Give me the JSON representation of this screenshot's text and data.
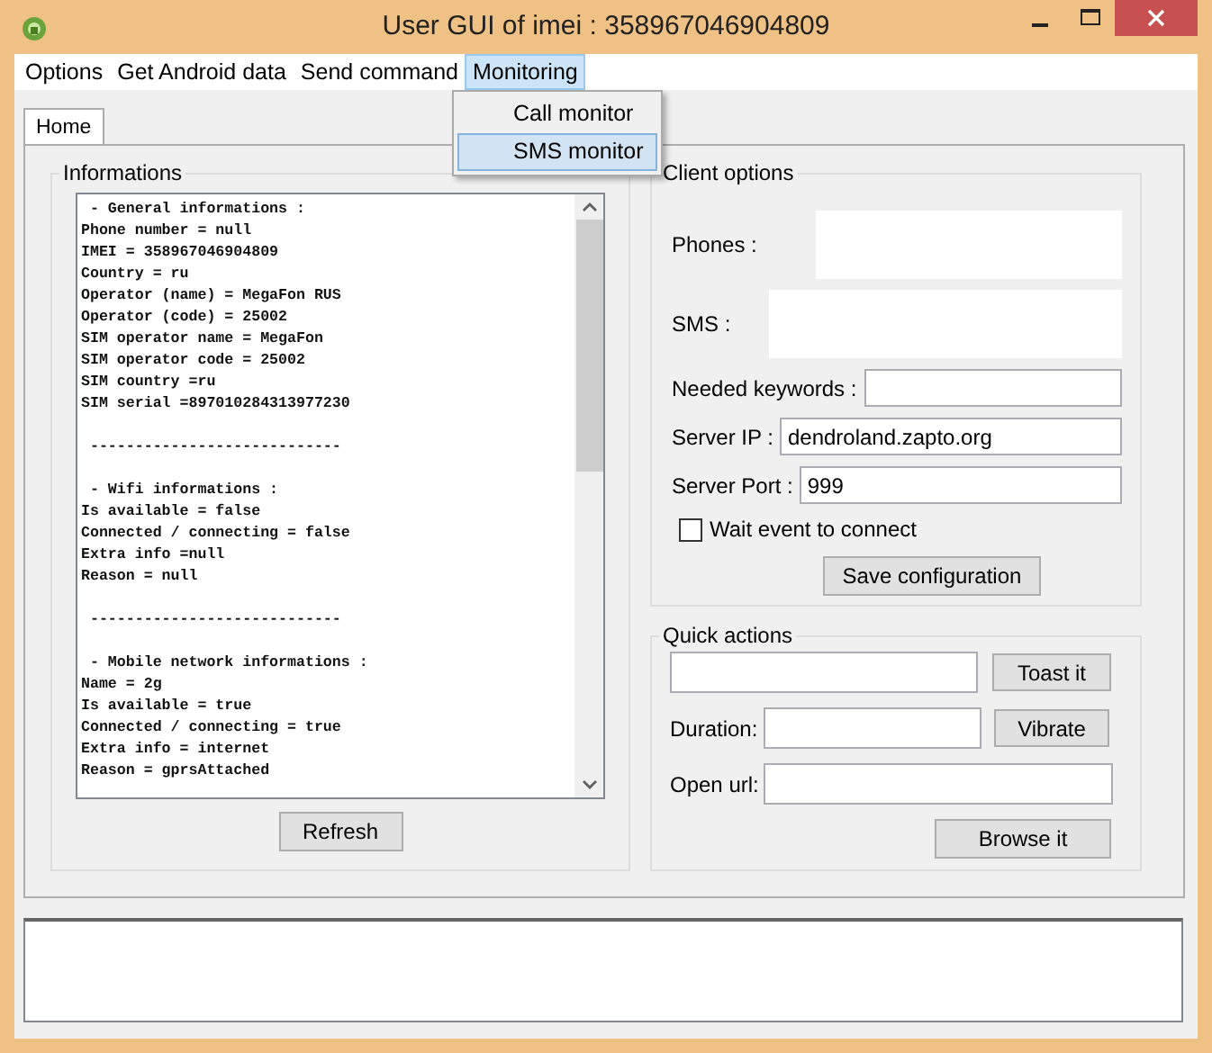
{
  "window": {
    "title": "User GUI of imei : 358967046904809"
  },
  "menu": [
    {
      "label": "Options",
      "selected": false
    },
    {
      "label": "Get Android data",
      "selected": false
    },
    {
      "label": "Send command",
      "selected": false
    },
    {
      "label": "Monitoring",
      "selected": true,
      "expanded": true,
      "items": [
        {
          "label": "Call monitor",
          "selected": false
        },
        {
          "label": "SMS monitor",
          "selected": true
        }
      ]
    }
  ],
  "tabs": [
    {
      "label": "Home",
      "selected": true
    }
  ],
  "informations": {
    "title": "Informations",
    "sections": [
      [
        " - General informations :",
        "Phone number = null",
        "IMEI = 358967046904809",
        "Country = ru",
        "Operator (name) = MegaFon RUS",
        "Operator (code) = 25002",
        "SIM operator name = MegaFon",
        "SIM operator code = 25002",
        "SIM country =ru",
        "SIM serial =897010284313977230"
      ],
      [
        " ----------------------------"
      ],
      [
        " - Wifi informations :",
        "Is available = false",
        "Connected / connecting = false",
        "Extra info =null",
        "Reason = null"
      ],
      [
        " ----------------------------"
      ],
      [
        " - Mobile network informations :",
        "Name = 2g",
        "Is available = true",
        "Connected / connecting = true",
        "Extra info = internet",
        "Reason = gprsAttached"
      ]
    ],
    "button": "Refresh"
  },
  "client_options": {
    "title": "Client options",
    "fields": [
      {
        "kind": "area",
        "label": "Phones :"
      },
      {
        "kind": "area",
        "label": "SMS :"
      },
      {
        "kind": "input",
        "label": "Needed keywords :"
      },
      {
        "kind": "input",
        "label": "Server IP :",
        "value": "dendroland.zapto.org"
      },
      {
        "kind": "input",
        "label": "Server Port :",
        "value": "999"
      }
    ],
    "checkbox": {
      "label": "Wait event to connect",
      "checked": false
    },
    "button": "Save configuration"
  },
  "quick_actions": {
    "title": "Quick actions",
    "rows": [
      {
        "button": "Toast it"
      },
      {
        "label": "Duration:",
        "button": "Vibrate"
      },
      {
        "label": "Open url:"
      }
    ],
    "button": "Browse it"
  }
}
